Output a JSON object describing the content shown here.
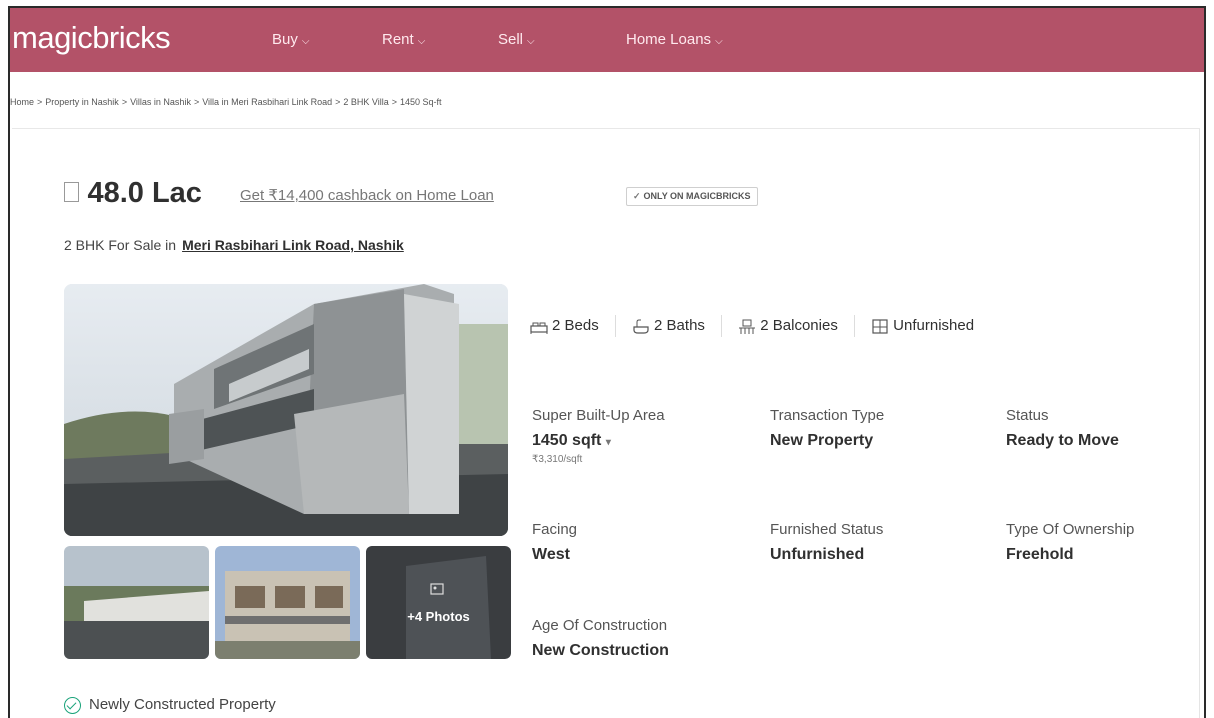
{
  "nav": {
    "logo": "magicbricks",
    "items": [
      "Buy",
      "Rent",
      "Sell",
      "Home Loans"
    ],
    "brand_color": "#b35268"
  },
  "breadcrumb": [
    "Home",
    "Property in Nashik",
    "Villas in Nashik",
    "Villa in Meri Rasbihari Link Road",
    "2 BHK Villa",
    "1450 Sq-ft"
  ],
  "listing": {
    "price": "48.0 Lac",
    "cashback": "Get ₹14,400 cashback on Home Loan",
    "badge": "ONLY ON MAGICBRICKS",
    "subtitle_prefix": "2 BHK For Sale in",
    "location": "Meri Rasbihari Link Road, Nashik"
  },
  "gallery": {
    "more_photos": "+4 Photos"
  },
  "features": {
    "beds": "2 Beds",
    "baths": "2 Baths",
    "balconies": "2 Balconies",
    "furnishing": "Unfurnished"
  },
  "details": {
    "area_label": "Super Built-Up Area",
    "area_value": "1450 sqft",
    "area_rate": "₹3,310/sqft",
    "transaction_label": "Transaction Type",
    "transaction_value": "New Property",
    "status_label": "Status",
    "status_value": "Ready to Move",
    "facing_label": "Facing",
    "facing_value": "West",
    "furnished_label": "Furnished Status",
    "furnished_value": "Unfurnished",
    "ownership_label": "Type Of Ownership",
    "ownership_value": "Freehold",
    "age_label": "Age Of Construction",
    "age_value": "New Construction"
  },
  "highlight": "Newly Constructed Property"
}
